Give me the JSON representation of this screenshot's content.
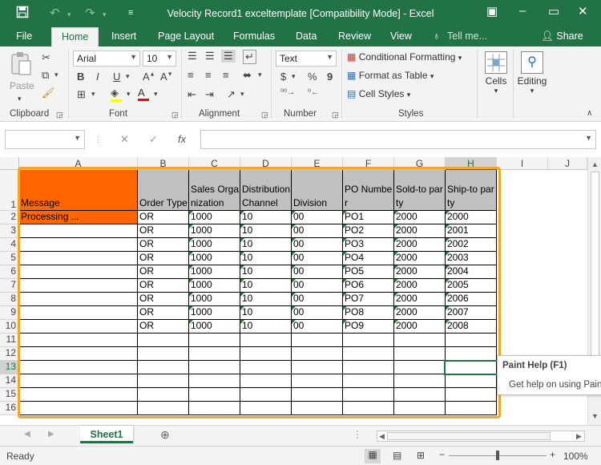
{
  "window": {
    "title": "Velocity Record1 exceltemplate  [Compatibility Mode] - Excel"
  },
  "ribbon": {
    "tabs": [
      "File",
      "Home",
      "Insert",
      "Page Layout",
      "Formulas",
      "Data",
      "Review",
      "View"
    ],
    "tell_me": "Tell me...",
    "share": "Share",
    "clipboard": {
      "paste": "Paste",
      "label": "Clipboard"
    },
    "font": {
      "name": "Arial",
      "size": "10",
      "label": "Font"
    },
    "alignment": {
      "label": "Alignment"
    },
    "number": {
      "format": "Text",
      "currency": "$",
      "percent": "%",
      "comma": "9",
      "label": "Number"
    },
    "styles": {
      "conditional": "Conditional Formatting",
      "format_table": "Format as Table",
      "cell_styles": "Cell Styles",
      "label": "Styles"
    },
    "cells": "Cells",
    "editing": "Editing"
  },
  "formula_bar": {
    "name_box": "",
    "fx": "fx",
    "value": ""
  },
  "grid": {
    "columns": [
      "A",
      "B",
      "C",
      "D",
      "E",
      "F",
      "G",
      "H",
      "I",
      "J"
    ],
    "rows": [
      "1",
      "2",
      "3",
      "4",
      "5",
      "6",
      "7",
      "8",
      "9",
      "10",
      "11",
      "12",
      "13",
      "14",
      "15",
      "16"
    ],
    "headers": [
      "Message",
      "Order Type",
      "Sales Organization",
      "Distribution Channel",
      "Division",
      "PO Number",
      "Sold-to party",
      "Ship-to party"
    ],
    "data": [
      [
        "Processing ...",
        "OR",
        "1000",
        "10",
        "00",
        "PO1",
        "2000",
        "2000"
      ],
      [
        "",
        "OR",
        "1000",
        "10",
        "00",
        "PO2",
        "2000",
        "2001"
      ],
      [
        "",
        "OR",
        "1000",
        "10",
        "00",
        "PO3",
        "2000",
        "2002"
      ],
      [
        "",
        "OR",
        "1000",
        "10",
        "00",
        "PO4",
        "2000",
        "2003"
      ],
      [
        "",
        "OR",
        "1000",
        "10",
        "00",
        "PO5",
        "2000",
        "2004"
      ],
      [
        "",
        "OR",
        "1000",
        "10",
        "00",
        "PO6",
        "2000",
        "2005"
      ],
      [
        "",
        "OR",
        "1000",
        "10",
        "00",
        "PO7",
        "2000",
        "2006"
      ],
      [
        "",
        "OR",
        "1000",
        "10",
        "00",
        "PO8",
        "2000",
        "2007"
      ],
      [
        "",
        "OR",
        "1000",
        "10",
        "00",
        "PO9",
        "2000",
        "2008"
      ]
    ]
  },
  "tooltip": {
    "title": "Paint Help (F1)",
    "text": "Get help on using Pain"
  },
  "sheets": [
    "Sheet1"
  ],
  "status": {
    "ready": "Ready",
    "zoom": "100%"
  },
  "colors": {
    "accent": "#217346",
    "message_fill": "#ff6600",
    "header_fill": "#c0c0c0",
    "selection_border": "#f5a623"
  }
}
